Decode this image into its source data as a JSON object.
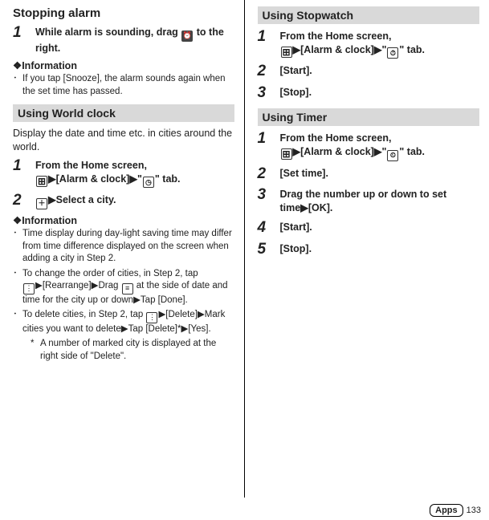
{
  "left": {
    "title1": "Stopping alarm",
    "step1": {
      "num": "1",
      "body_a": "While alarm is sounding, drag ",
      "body_b": " to the right."
    },
    "infoHead1": "❖Information",
    "info1": "If you tap [Snooze], the alarm sounds again when the set time has passed.",
    "bar1": "Using World clock",
    "intro1": "Display the date and time etc. in cities around the world.",
    "wc_step1": {
      "num": "1",
      "a": "From the Home screen, ",
      "b": "[Alarm & clock]",
      "c": "\"",
      "d": "\" tab."
    },
    "wc_step2": {
      "num": "2",
      "a": "Select a city."
    },
    "infoHead2": "❖Information",
    "wc_info1": "Time display during day-light saving time may differ from time difference displayed on the screen when adding a city in Step 2.",
    "wc_info2_a": "To change the order of cities, in Step 2, tap ",
    "wc_info2_b": "[Rearrange]",
    "wc_info2_c": "Drag ",
    "wc_info2_d": " at the side of date and time for the city up or down",
    "wc_info2_e": "Tap [Done].",
    "wc_info3_a": "To delete cities, in Step 2, tap ",
    "wc_info3_b": "[Delete]",
    "wc_info3_c": "Mark cities you want to delete",
    "wc_info3_d": "Tap [Delete]*",
    "wc_info3_e": "[Yes].",
    "wc_sub": "A number of marked city is displayed at the right side of \"Delete\"."
  },
  "right": {
    "bar1": "Using Stopwatch",
    "sw_step1": {
      "num": "1",
      "a": "From the Home screen, ",
      "b": "[Alarm & clock]",
      "c": "\"",
      "d": "\" tab."
    },
    "sw_step2": {
      "num": "2",
      "a": "[Start]."
    },
    "sw_step3": {
      "num": "3",
      "a": "[Stop]."
    },
    "bar2": "Using Timer",
    "tm_step1": {
      "num": "1",
      "a": "From the Home screen, ",
      "b": "[Alarm & clock]",
      "c": "\"",
      "d": "\" tab."
    },
    "tm_step2": {
      "num": "2",
      "a": "[Set time]."
    },
    "tm_step3": {
      "num": "3",
      "a": "Drag the number up or down to set time",
      "b": "[OK]."
    },
    "tm_step4": {
      "num": "4",
      "a": "[Start]."
    },
    "tm_step5": {
      "num": "5",
      "a": "[Stop]."
    }
  },
  "footer": {
    "apps": "Apps",
    "page": "133"
  },
  "glyphs": {
    "tri": "▶",
    "plus": "＋",
    "dots": "⋮",
    "drag": "≡",
    "clock": "◷",
    "stopwatch": "⏱",
    "timer": "⏲",
    "alarm": "⏰"
  }
}
